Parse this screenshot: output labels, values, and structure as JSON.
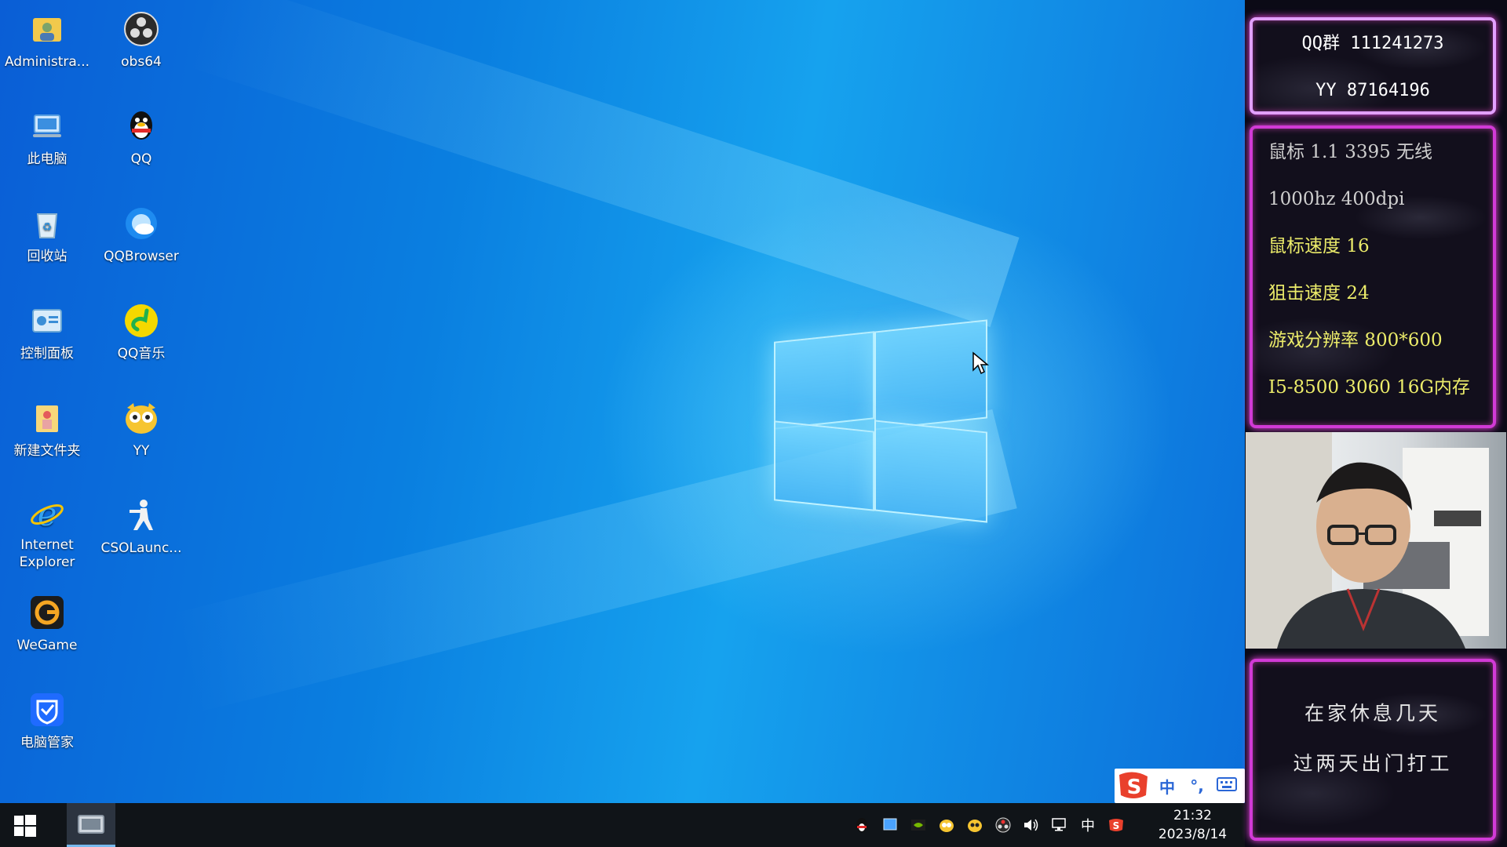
{
  "desktop": {
    "icons": [
      {
        "label": "Administra...",
        "icon": "user-folder-icon"
      },
      {
        "label": "obs64",
        "icon": "obs-icon"
      },
      {
        "label": "此电脑",
        "icon": "computer-icon"
      },
      {
        "label": "QQ",
        "icon": "qq-penguin-icon"
      },
      {
        "label": "回收站",
        "icon": "recycle-bin-icon"
      },
      {
        "label": "QQBrowser",
        "icon": "qq-browser-icon"
      },
      {
        "label": "控制面板",
        "icon": "control-panel-icon"
      },
      {
        "label": "QQ音乐",
        "icon": "qq-music-icon"
      },
      {
        "label": "新建文件夹",
        "icon": "folder-icon"
      },
      {
        "label": "YY",
        "icon": "yy-icon"
      },
      {
        "label": "Internet\nExplorer",
        "icon": "internet-explorer-icon"
      },
      {
        "label": "CSOLaunc...",
        "icon": "cso-launcher-icon"
      },
      {
        "label": "WeGame",
        "icon": "wegame-icon"
      },
      {
        "label": "电脑管家",
        "icon": "pc-manager-icon"
      }
    ]
  },
  "ime": {
    "mode": "中",
    "punct": "°,"
  },
  "taskbar": {
    "tray_lang": "中",
    "time": "21:32",
    "date": "2023/8/14"
  },
  "overlay": {
    "contact": {
      "qq": "QQ群 111241273",
      "yy": "YY  87164196"
    },
    "specs": [
      {
        "text": "鼠标 1.1 3395 无线",
        "color": "#cfcfcf"
      },
      {
        "text": "1000hz 400dpi",
        "color": "#cfcfcf"
      },
      {
        "text": "鼠标速度 16",
        "color": "#ecec6a"
      },
      {
        "text": "狙击速度 24",
        "color": "#ecec6a"
      },
      {
        "text": "游戏分辨率 800*600",
        "color": "#ecec6a"
      },
      {
        "text": "I5-8500 3060 16G内存",
        "color": "#ecec6a"
      }
    ],
    "note": [
      "在家休息几天",
      "过两天出门打工"
    ]
  },
  "colors": {
    "panel_border": "#d13ad6",
    "accent": "#76b9ed"
  }
}
